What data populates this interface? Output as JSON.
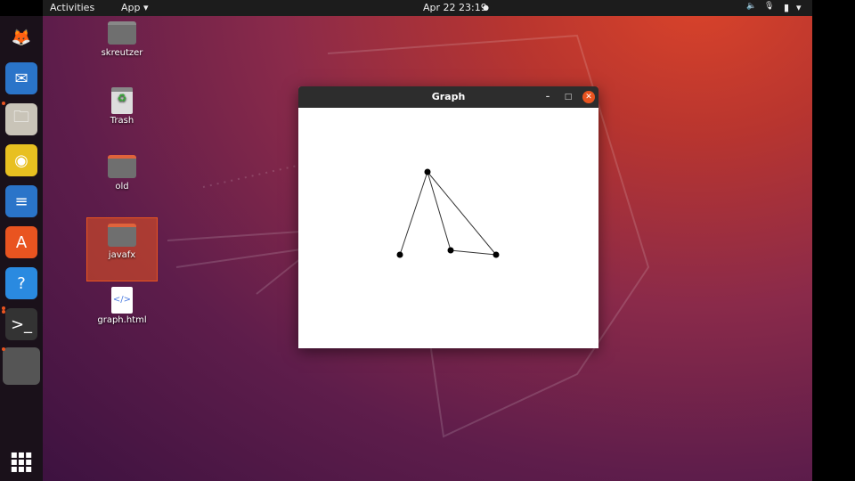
{
  "topbar": {
    "activities": "Activities",
    "app_menu": "App ▾",
    "clock": "Apr 22  23:19",
    "status_dot": "●",
    "volume_icon": "🔈",
    "mic_icon": "🎙",
    "battery_icon": "▮",
    "menu_arrow": "▾"
  },
  "dock": {
    "items": [
      {
        "name": "firefox",
        "glyph": "🦊",
        "bg": "transparent"
      },
      {
        "name": "thunderbird",
        "glyph": "✉",
        "bg": "#2a74c9"
      },
      {
        "name": "files",
        "glyph": "🗀",
        "bg": "#c9c4b8"
      },
      {
        "name": "rhythmbox",
        "glyph": "◉",
        "bg": "#e8c020"
      },
      {
        "name": "libreoffice-writer",
        "glyph": "≡",
        "bg": "#2a74c9"
      },
      {
        "name": "software",
        "glyph": "A",
        "bg": "#e95420"
      },
      {
        "name": "help",
        "glyph": "?",
        "bg": "#2a8ae0"
      },
      {
        "name": "terminal",
        "glyph": ">_",
        "bg": "#333"
      },
      {
        "name": "java-app",
        "glyph": "",
        "bg": "#555"
      }
    ],
    "show_apps": "⋮⋮⋮"
  },
  "desktop": {
    "icons": [
      {
        "label": "skreutzer",
        "type": "home"
      },
      {
        "label": "Trash",
        "type": "trash"
      },
      {
        "label": "old",
        "type": "folder"
      },
      {
        "label": "javafx",
        "type": "folder"
      },
      {
        "label": "graph.html",
        "type": "html"
      }
    ]
  },
  "window": {
    "title": "Graph",
    "minimize": "–",
    "maximize": "□",
    "close": "✕",
    "graph": {
      "nodes": 4,
      "edges": [
        [
          0,
          1
        ],
        [
          0,
          2
        ],
        [
          0,
          3
        ],
        [
          2,
          3
        ]
      ]
    }
  },
  "colors": {
    "accent": "#e95420"
  }
}
